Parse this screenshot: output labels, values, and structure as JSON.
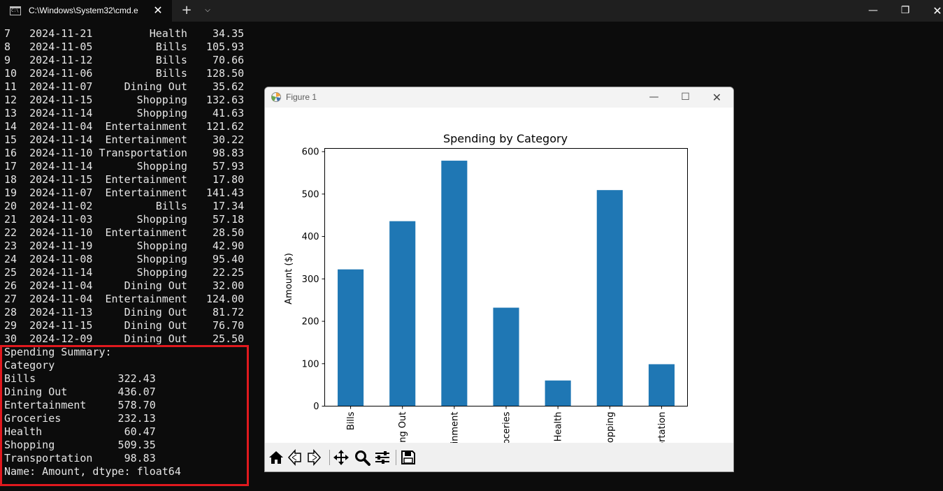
{
  "terminal": {
    "tab_title": "C:\\Windows\\System32\\cmd.e",
    "rows": [
      {
        "idx": "7",
        "date": "2024-11-21",
        "category": "Health",
        "amount": "34.35"
      },
      {
        "idx": "8",
        "date": "2024-11-05",
        "category": "Bills",
        "amount": "105.93"
      },
      {
        "idx": "9",
        "date": "2024-11-12",
        "category": "Bills",
        "amount": "70.66"
      },
      {
        "idx": "10",
        "date": "2024-11-06",
        "category": "Bills",
        "amount": "128.50"
      },
      {
        "idx": "11",
        "date": "2024-11-07",
        "category": "Dining Out",
        "amount": "35.62"
      },
      {
        "idx": "12",
        "date": "2024-11-15",
        "category": "Shopping",
        "amount": "132.63"
      },
      {
        "idx": "13",
        "date": "2024-11-14",
        "category": "Shopping",
        "amount": "41.63"
      },
      {
        "idx": "14",
        "date": "2024-11-04",
        "category": "Entertainment",
        "amount": "121.62"
      },
      {
        "idx": "15",
        "date": "2024-11-14",
        "category": "Entertainment",
        "amount": "30.22"
      },
      {
        "idx": "16",
        "date": "2024-11-10",
        "category": "Transportation",
        "amount": "98.83"
      },
      {
        "idx": "17",
        "date": "2024-11-14",
        "category": "Shopping",
        "amount": "57.93"
      },
      {
        "idx": "18",
        "date": "2024-11-15",
        "category": "Entertainment",
        "amount": "17.80"
      },
      {
        "idx": "19",
        "date": "2024-11-07",
        "category": "Entertainment",
        "amount": "141.43"
      },
      {
        "idx": "20",
        "date": "2024-11-02",
        "category": "Bills",
        "amount": "17.34"
      },
      {
        "idx": "21",
        "date": "2024-11-03",
        "category": "Shopping",
        "amount": "57.18"
      },
      {
        "idx": "22",
        "date": "2024-11-10",
        "category": "Entertainment",
        "amount": "28.50"
      },
      {
        "idx": "23",
        "date": "2024-11-19",
        "category": "Shopping",
        "amount": "42.90"
      },
      {
        "idx": "24",
        "date": "2024-11-08",
        "category": "Shopping",
        "amount": "95.40"
      },
      {
        "idx": "25",
        "date": "2024-11-14",
        "category": "Shopping",
        "amount": "22.25"
      },
      {
        "idx": "26",
        "date": "2024-11-04",
        "category": "Dining Out",
        "amount": "32.00"
      },
      {
        "idx": "27",
        "date": "2024-11-04",
        "category": "Entertainment",
        "amount": "124.00"
      },
      {
        "idx": "28",
        "date": "2024-11-13",
        "category": "Dining Out",
        "amount": "81.72"
      },
      {
        "idx": "29",
        "date": "2024-11-15",
        "category": "Dining Out",
        "amount": "76.70"
      },
      {
        "idx": "30",
        "date": "2024-12-09",
        "category": "Dining Out",
        "amount": "25.50"
      }
    ],
    "summary_title": "Spending Summary:",
    "summary_index_name": "Category",
    "summary": [
      {
        "category": "Bills",
        "amount": "322.43"
      },
      {
        "category": "Dining Out",
        "amount": "436.07"
      },
      {
        "category": "Entertainment",
        "amount": "578.70"
      },
      {
        "category": "Groceries",
        "amount": "232.13"
      },
      {
        "category": "Health",
        "amount": "60.47"
      },
      {
        "category": "Shopping",
        "amount": "509.35"
      },
      {
        "category": "Transportation",
        "amount": "98.83"
      }
    ],
    "summary_footer": "Name: Amount, dtype: float64",
    "highlight_color": "#e0191e"
  },
  "figure": {
    "window_title": "Figure 1",
    "toolbar_icons": [
      "home-icon",
      "back-icon",
      "forward-icon",
      "pan-icon",
      "zoom-icon",
      "configure-subplots-icon",
      "save-icon"
    ]
  },
  "chart_data": {
    "type": "bar",
    "title": "Spending by Category",
    "xlabel": "",
    "ylabel": "Amount ($)",
    "categories": [
      "Bills",
      "Dining Out",
      "Entertainment",
      "Groceries",
      "Health",
      "Shopping",
      "Transportation"
    ],
    "values": [
      322.43,
      436.07,
      578.7,
      232.13,
      60.47,
      509.35,
      98.83
    ],
    "yticks": [
      0,
      100,
      200,
      300,
      400,
      500,
      600
    ],
    "ylim": [
      0,
      607.6
    ],
    "bar_color": "#1f77b4",
    "grid": false,
    "tick_label_rotation": "vertical"
  }
}
